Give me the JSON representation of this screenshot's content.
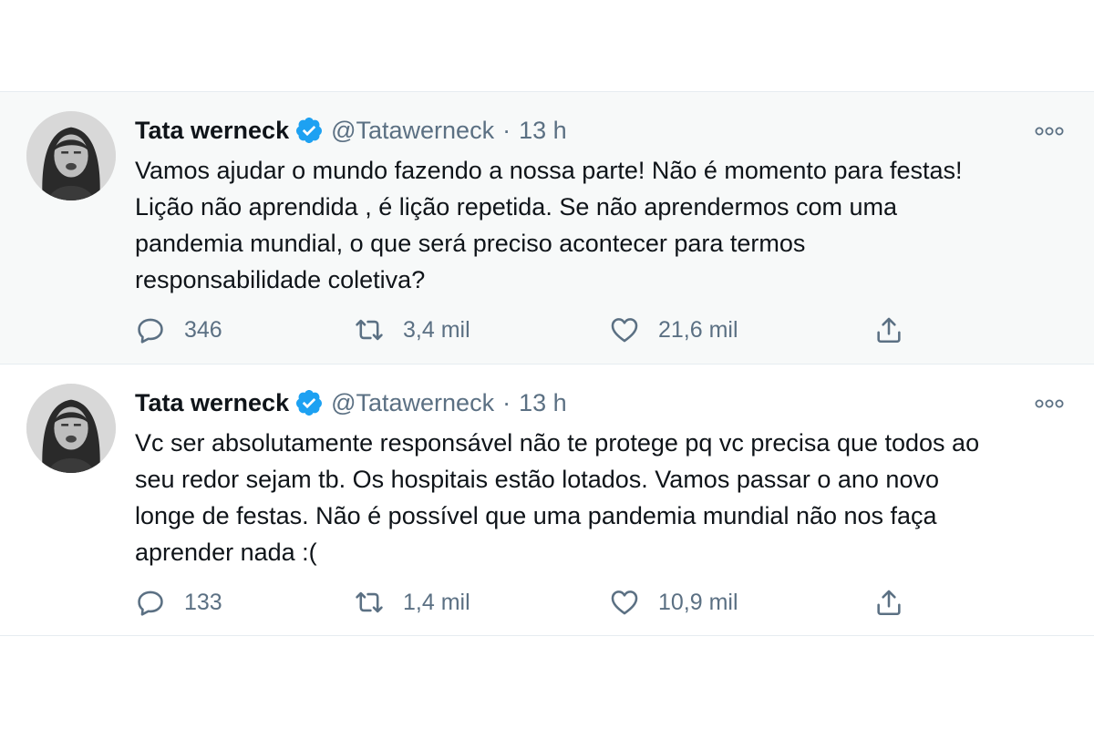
{
  "tweets": [
    {
      "author": "Tata werneck",
      "handle": "@Tatawerneck",
      "separator": "·",
      "time": "13 h",
      "text": "Vamos ajudar o mundo fazendo a nossa parte! Não é momento para festas!\nLição não aprendida , é lição repetida. Se não aprendermos com uma\npandemia mundial, o que será preciso acontecer para termos\nresponsabilidade coletiva?",
      "replies": "346",
      "retweets": "3,4 mil",
      "likes": "21,6 mil"
    },
    {
      "author": "Tata werneck",
      "handle": "@Tatawerneck",
      "separator": "·",
      "time": "13 h",
      "text": "Vc ser absolutamente responsável não te protege pq vc precisa que todos ao\nseu redor sejam tb. Os hospitais estão lotados. Vamos passar o ano novo\nlonge de festas. Não é possível que uma pandemia mundial não nos faça\naprender nada :(",
      "replies": "133",
      "retweets": "1,4 mil",
      "likes": "10,9 mil"
    }
  ],
  "colors": {
    "verified": "#1da1f2",
    "muted": "#5b7083",
    "highlight_background": "#f7f9f9"
  },
  "icons": [
    "verified-badge-icon",
    "more-options-icon",
    "reply-icon",
    "retweet-icon",
    "like-icon",
    "share-icon"
  ]
}
